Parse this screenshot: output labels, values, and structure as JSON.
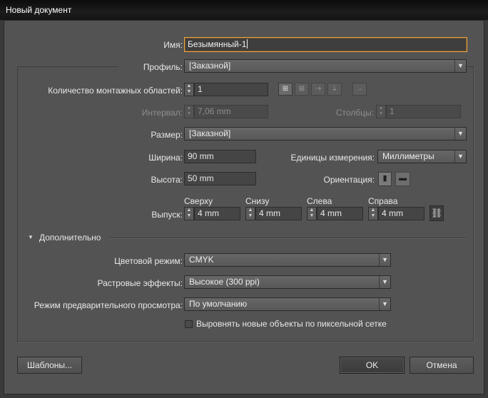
{
  "window": {
    "title": "Новый документ"
  },
  "name": {
    "label": "Имя:",
    "value": "Безымянный-1"
  },
  "profile": {
    "label": "Профиль:",
    "value": "[Заказной]"
  },
  "artboards": {
    "label": "Количество монтажных областей:",
    "value": "1"
  },
  "interval": {
    "label": "Интервал:",
    "value": "7,06 mm"
  },
  "columns": {
    "label": "Столбцы:",
    "value": "1"
  },
  "size": {
    "label": "Размер:",
    "value": "[Заказной]"
  },
  "width": {
    "label": "Ширина:",
    "value": "90 mm"
  },
  "height": {
    "label": "Высота:",
    "value": "50 mm"
  },
  "units": {
    "label": "Единицы измерения:",
    "value": "Миллиметры"
  },
  "orientation": {
    "label": "Ориентация:"
  },
  "bleed": {
    "label": "Выпуск:",
    "top": {
      "label": "Сверху",
      "value": "4 mm"
    },
    "bottom": {
      "label": "Снизу",
      "value": "4 mm"
    },
    "left": {
      "label": "Слева",
      "value": "4 mm"
    },
    "right": {
      "label": "Справа",
      "value": "4 mm"
    }
  },
  "advanced": {
    "label": "Дополнительно",
    "color_mode": {
      "label": "Цветовой режим:",
      "value": "CMYK"
    },
    "raster": {
      "label": "Растровые эффекты:",
      "value": "Высокое (300 ppi)"
    },
    "preview": {
      "label": "Режим предварительного просмотра:",
      "value": "По умолчанию"
    },
    "align_pixel": {
      "label": "Выровнять новые объекты по пиксельной сетке",
      "checked": false
    }
  },
  "buttons": {
    "templates": "Шаблоны...",
    "ok": "OK",
    "cancel": "Отмена"
  },
  "icons": [
    "grid-by-row-icon",
    "grid-by-column-icon",
    "arrange-by-row-icon",
    "arrange-by-column-icon",
    "layout-direction-icon",
    "portrait-icon",
    "landscape-icon",
    "link-icon",
    "disclosure-triangle-icon",
    "dropdown-arrow-icon",
    "spin-arrows-icon"
  ],
  "colors": {
    "dialog_bg": "#535353",
    "focus_border": "#e5a64a",
    "titlebar": "#141414"
  }
}
